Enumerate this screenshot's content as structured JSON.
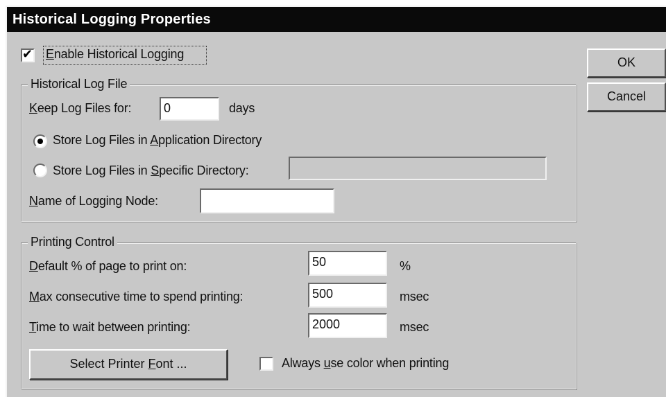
{
  "window": {
    "title": "Historical Logging Properties"
  },
  "enable_logging": {
    "pre": "",
    "accel": "E",
    "rest": "nable Historical Logging",
    "checked": true
  },
  "buttons": {
    "ok": "OK",
    "cancel": "Cancel"
  },
  "log_file_group": {
    "title": "Historical Log File",
    "keep_for": {
      "accel": "K",
      "rest": "eep Log Files for:"
    },
    "keep_days_value": "0",
    "days_unit": "days",
    "store_app_dir": {
      "pre": "Store Log Files in ",
      "accel": "A",
      "rest": "pplication Directory",
      "selected": true
    },
    "store_specific_dir": {
      "pre": "Store Log Files in ",
      "accel": "S",
      "rest": "pecific Directory:",
      "selected": false
    },
    "specific_dir_value": "",
    "node_name": {
      "accel": "N",
      "rest": "ame of Logging Node:"
    },
    "node_name_value": ""
  },
  "printing_group": {
    "title": "Printing Control",
    "default_pct": {
      "accel": "D",
      "rest": "efault % of page to print on:"
    },
    "default_pct_value": "50",
    "default_pct_unit": "%",
    "max_time": {
      "accel": "M",
      "rest": "ax consecutive time to spend printing:"
    },
    "max_time_value": "500",
    "max_time_unit": "msec",
    "wait_time": {
      "accel": "T",
      "rest": "ime to wait between printing:"
    },
    "wait_time_value": "2000",
    "wait_time_unit": "msec",
    "select_font": {
      "pre": "Select Printer ",
      "accel": "F",
      "rest": "ont ..."
    },
    "always_color": {
      "pre": "Always ",
      "accel": "u",
      "rest": "se color when printing",
      "checked": false
    }
  }
}
